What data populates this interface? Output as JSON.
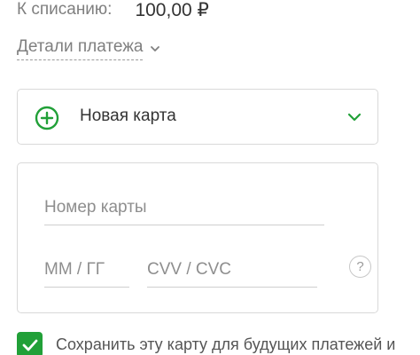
{
  "charge": {
    "label": "К списанию:",
    "amount": "100,00 ₽"
  },
  "details": {
    "label": "Детали платежа",
    "icon": "chevron-down-icon"
  },
  "card_select": {
    "label": "Новая карта",
    "icon": "plus-circle-icon",
    "chevron": "chevron-down-icon"
  },
  "card_form": {
    "card_number_placeholder": "Номер карты",
    "expiry_placeholder": "ММ / ГГ",
    "cvv_placeholder": "CVV / CVC",
    "help_label": "?"
  },
  "save_card": {
    "checked": true,
    "label": "Сохранить эту карту для будущих платежей и"
  },
  "colors": {
    "accent": "#21a038",
    "border": "#d9d9d9",
    "muted_text": "#7f7f7f"
  }
}
